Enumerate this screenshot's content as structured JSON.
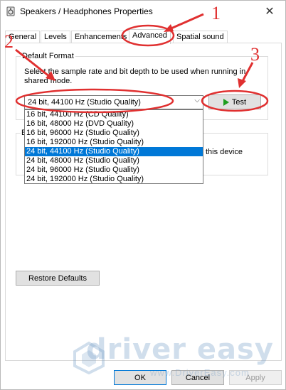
{
  "window": {
    "title": "Speakers / Headphones Properties",
    "close_glyph": "✕"
  },
  "tabs": [
    {
      "label": "General"
    },
    {
      "label": "Levels"
    },
    {
      "label": "Enhancements"
    },
    {
      "label": "Advanced"
    },
    {
      "label": "Spatial sound"
    }
  ],
  "default_format": {
    "group_label": "Default Format",
    "description": "Select the sample rate and bit depth to be used when running in shared mode.",
    "selected_value": "24 bit, 44100 Hz (Studio Quality)",
    "test_label": "Test",
    "options": [
      "16 bit, 44100 Hz (CD Quality)",
      "16 bit, 48000 Hz (DVD Quality)",
      "16 bit, 96000 Hz (Studio Quality)",
      "16 bit, 192000 Hz (Studio Quality)",
      "24 bit, 44100 Hz (Studio Quality)",
      "24 bit, 48000 Hz (Studio Quality)",
      "24 bit, 96000 Hz (Studio Quality)",
      "24 bit, 192000 Hz (Studio Quality)"
    ],
    "highlighted_index": 4
  },
  "exclusive": {
    "group_label_fragment": "E",
    "partial_text": "this device"
  },
  "restore_label": "Restore Defaults",
  "footer": {
    "ok_label": "OK",
    "cancel_label": "Cancel",
    "apply_label": "Apply"
  },
  "annotations": {
    "n1": "1",
    "n2": "2",
    "n3": "3",
    "color": "#e03030"
  },
  "watermark": {
    "brand": "driver easy",
    "url": "www.DriverEasy.com"
  }
}
